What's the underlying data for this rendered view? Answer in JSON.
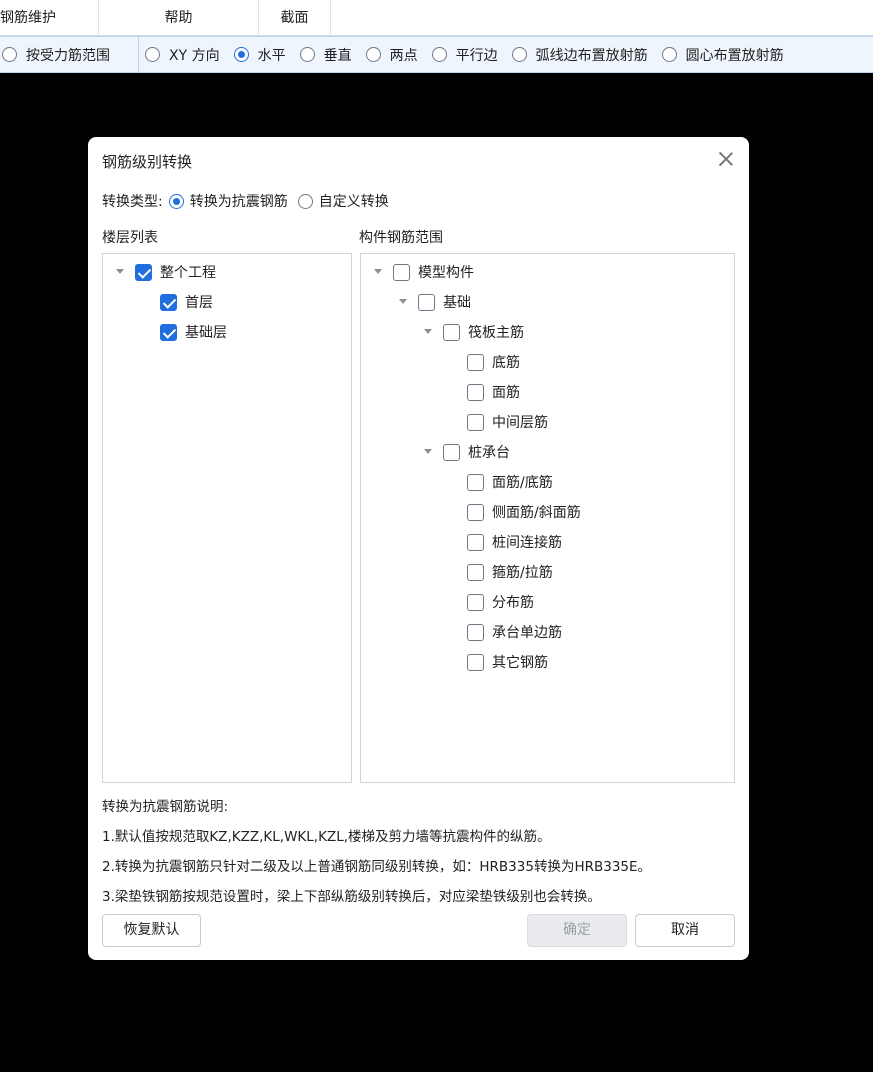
{
  "menubar": {
    "items": [
      "钢筋维护",
      "帮助",
      "截面"
    ]
  },
  "toolbar": {
    "range_option": {
      "label": "按受力筋范围",
      "selected": false
    },
    "options": [
      {
        "label": "XY 方向",
        "selected": false
      },
      {
        "label": "水平",
        "selected": true
      },
      {
        "label": "垂直",
        "selected": false
      },
      {
        "label": "两点",
        "selected": false
      },
      {
        "label": "平行边",
        "selected": false
      },
      {
        "label": "弧线边布置放射筋",
        "selected": false
      },
      {
        "label": "圆心布置放射筋",
        "selected": false
      }
    ]
  },
  "dialog": {
    "title": "钢筋级别转换",
    "type_label": "转换类型:",
    "type_options": [
      {
        "label": "转换为抗震钢筋",
        "selected": true
      },
      {
        "label": "自定义转换",
        "selected": false
      }
    ],
    "floor_list_label": "楼层列表",
    "component_range_label": "构件钢筋范围",
    "floor_tree": [
      {
        "label": "整个工程",
        "checked": true,
        "expandable": true
      },
      {
        "label": "首层",
        "checked": true,
        "expandable": false
      },
      {
        "label": "基础层",
        "checked": true,
        "expandable": false
      }
    ],
    "component_tree": [
      {
        "label": "模型构件",
        "checked": false,
        "expandable": true
      },
      {
        "label": "基础",
        "checked": false,
        "expandable": true
      },
      {
        "label": "筏板主筋",
        "checked": false,
        "expandable": true
      },
      {
        "label": "底筋",
        "checked": false,
        "expandable": false
      },
      {
        "label": "面筋",
        "checked": false,
        "expandable": false
      },
      {
        "label": "中间层筋",
        "checked": false,
        "expandable": false
      },
      {
        "label": "桩承台",
        "checked": false,
        "expandable": true
      },
      {
        "label": "面筋/底筋",
        "checked": false,
        "expandable": false
      },
      {
        "label": "侧面筋/斜面筋",
        "checked": false,
        "expandable": false
      },
      {
        "label": "桩间连接筋",
        "checked": false,
        "expandable": false
      },
      {
        "label": "箍筋/拉筋",
        "checked": false,
        "expandable": false
      },
      {
        "label": "分布筋",
        "checked": false,
        "expandable": false
      },
      {
        "label": "承台单边筋",
        "checked": false,
        "expandable": false
      },
      {
        "label": "其它钢筋",
        "checked": false,
        "expandable": false
      }
    ],
    "notes": {
      "title": "转换为抗震钢筋说明:",
      "line1": "1.默认值按规范取KZ,KZZ,KL,WKL,KZL,楼梯及剪力墙等抗震构件的纵筋。",
      "line2": "2.转换为抗震钢筋只针对二级及以上普通钢筋同级别转换，如：HRB335转换为HRB335E。",
      "line3": "3.梁垫铁钢筋按规范设置时，梁上下部纵筋级别转换后，对应梁垫铁级别也会转换。"
    },
    "buttons": {
      "reset": "恢复默认",
      "ok": "确定",
      "cancel": "取消"
    }
  }
}
